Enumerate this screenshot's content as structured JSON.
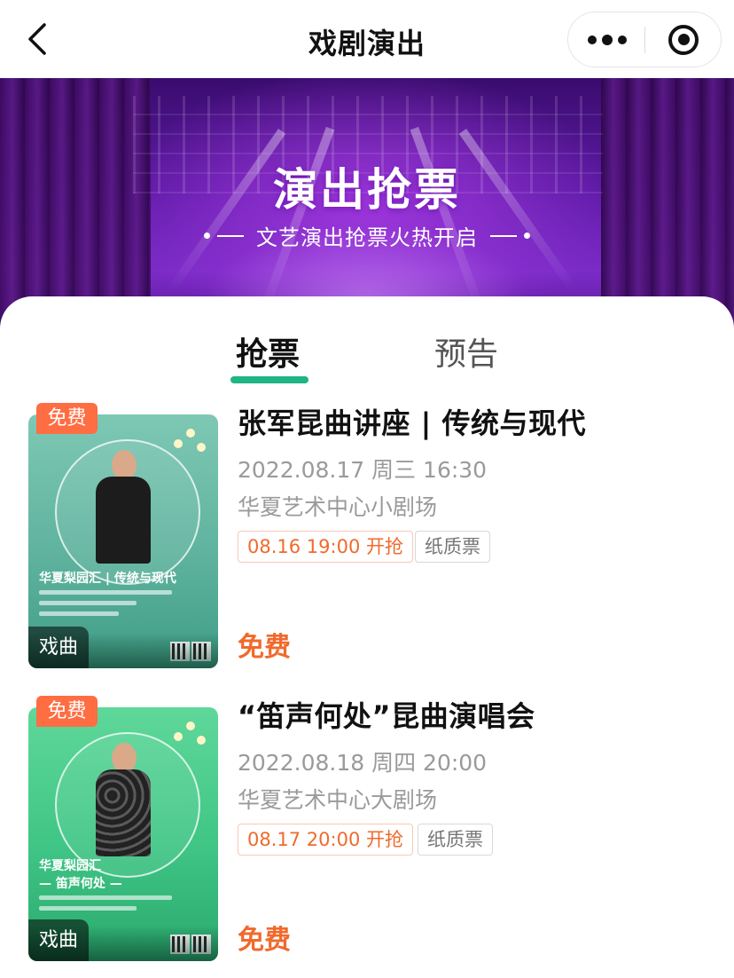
{
  "nav": {
    "title": "戏剧演出"
  },
  "banner": {
    "title": "演出抢票",
    "subtitle": "文艺演出抢票火热开启"
  },
  "tabs": [
    {
      "label": "抢票",
      "active": true
    },
    {
      "label": "预告",
      "active": false
    }
  ],
  "colors": {
    "accent_green": "#1fb584",
    "price_orange": "#f06a2c",
    "badge_orange": "#ff6d43"
  },
  "events": [
    {
      "badge": "免费",
      "category": "戏曲",
      "poster_title": "华夏梨园汇 | 传统与现代",
      "title": "张军昆曲讲座 | 传统与现代",
      "datetime": "2022.08.17 周三 16:30",
      "venue": "华夏艺术中心小剧场",
      "sale_start": "08.16 19:00 开抢",
      "ticket_type": "纸质票",
      "price": "免费"
    },
    {
      "badge": "免费",
      "category": "戏曲",
      "poster_title": "华夏梨园汇",
      "poster_subtitle": "— 笛声何处 —",
      "title": "“笛声何处”昆曲演唱会",
      "datetime": "2022.08.18 周四 20:00",
      "venue": "华夏艺术中心大剧场",
      "sale_start": "08.17 20:00 开抢",
      "ticket_type": "纸质票",
      "price": "免费"
    }
  ]
}
